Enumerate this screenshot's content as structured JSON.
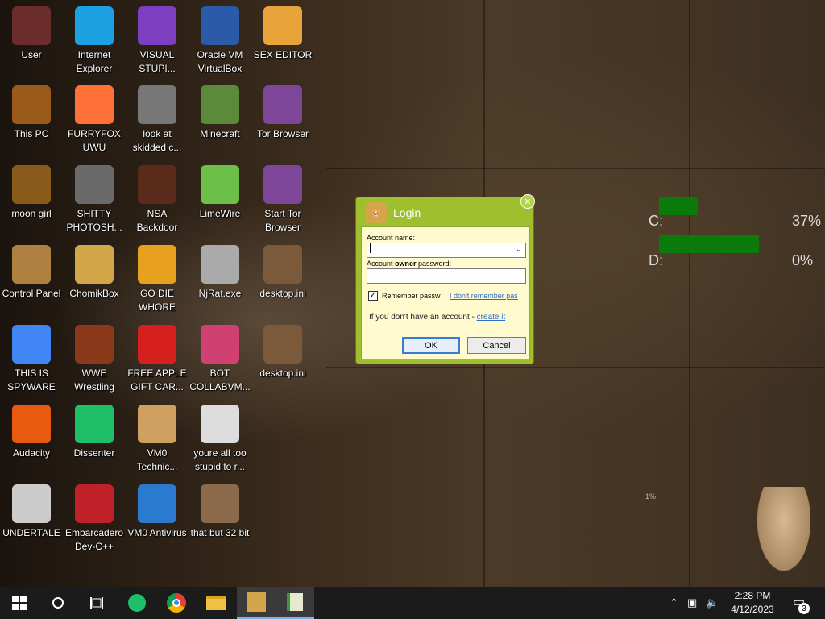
{
  "desktop_icons": [
    {
      "label": "User",
      "icon": "user-folder-icon",
      "color": "#6b2c2c"
    },
    {
      "label": "Internet Explorer",
      "icon": "edge-icon",
      "color": "#1ba1e2"
    },
    {
      "label": "VISUAL STUPI...",
      "icon": "visual-studio-icon",
      "color": "#7b3fbf"
    },
    {
      "label": "Oracle VM VirtualBox",
      "icon": "virtualbox-icon",
      "color": "#2a5aa8"
    },
    {
      "label": "SEX EDITOR",
      "icon": "hxd-icon",
      "color": "#e8a33a"
    },
    {
      "label": "This PC",
      "icon": "computer-icon",
      "color": "#9a5a1a"
    },
    {
      "label": "FURRYFOX UWU",
      "icon": "firefox-icon",
      "color": "#ff7139"
    },
    {
      "label": "look at skidded c...",
      "icon": "copy-icon",
      "color": "#777777"
    },
    {
      "label": "Minecraft",
      "icon": "minecraft-icon",
      "color": "#5a8a3a"
    },
    {
      "label": "Tor Browser",
      "icon": "tor-icon",
      "color": "#7d4698"
    },
    {
      "label": "moon girl",
      "icon": "book-icon",
      "color": "#8a5a1a"
    },
    {
      "label": "SHITTY PHOTOSH...",
      "icon": "gimp-icon",
      "color": "#6a6a6a"
    },
    {
      "label": "NSA Backdoor",
      "icon": "terminal-icon",
      "color": "#5a2a1a"
    },
    {
      "label": "LimeWire",
      "icon": "limewire-icon",
      "color": "#6cc04a"
    },
    {
      "label": "Start Tor Browser",
      "icon": "tor-icon",
      "color": "#7d4698"
    },
    {
      "label": "Control Panel",
      "icon": "lightbulb-icon",
      "color": "#b08040"
    },
    {
      "label": "ChomikBox",
      "icon": "chomikbox-icon",
      "color": "#d4a64a"
    },
    {
      "label": "GO DIE WHORE",
      "icon": "die-icon",
      "color": "#e8a020"
    },
    {
      "label": "NjRat.exe",
      "icon": "skull-icon",
      "color": "#aaaaaa"
    },
    {
      "label": "desktop.ini",
      "icon": "ini-file-icon",
      "color": "#7a5a3a"
    },
    {
      "label": "THIS IS SPYWARE",
      "icon": "chrome-icon",
      "color": "#4285f4"
    },
    {
      "label": "WWE Wrestling",
      "icon": "tv-icon",
      "color": "#8a3a1a"
    },
    {
      "label": "FREE APPLE GIFT CAR...",
      "icon": "apple-icon",
      "color": "#d62020"
    },
    {
      "label": "BOT COLLABVM...",
      "icon": "flash-icon",
      "color": "#d04070"
    },
    {
      "label": "desktop.ini",
      "icon": "ini-file-icon",
      "color": "#7a5a3a"
    },
    {
      "label": "Audacity",
      "icon": "audacity-icon",
      "color": "#e85a10"
    },
    {
      "label": "Dissenter",
      "icon": "dissenter-icon",
      "color": "#1fbf6a"
    },
    {
      "label": "VM0 Technic...",
      "icon": "technician-icon",
      "color": "#d0a060"
    },
    {
      "label": "youre all too stupid to r...",
      "icon": "portrait-icon",
      "color": "#dddddd"
    },
    {
      "label": "",
      "icon": "",
      "color": ""
    },
    {
      "label": "UNDERTALE",
      "icon": "unity-icon",
      "color": "#cccccc"
    },
    {
      "label": "Embarcadero Dev-C++",
      "icon": "devcpp-icon",
      "color": "#c0202a"
    },
    {
      "label": "VM0 Antivirus",
      "icon": "shield-icon",
      "color": "#2a7ad0"
    },
    {
      "label": "that but 32 bit",
      "icon": "portrait-icon",
      "color": "#8a6a4a"
    }
  ],
  "disk_gauge": {
    "drives": [
      {
        "label": "C:",
        "percent": "37%",
        "fill": 0.37
      },
      {
        "label": "D:",
        "percent": "0%",
        "fill": 0.0
      }
    ],
    "bar_color": "#0a7a0a"
  },
  "small_watermark": "1%",
  "login_dialog": {
    "title": "Login",
    "close_symbol": "✕",
    "account_name_label": "Account name:",
    "account_name_value": "",
    "password_label_pre": "Account ",
    "password_label_bold": "owner",
    "password_label_post": " password:",
    "remember_label": "Remember passw",
    "remember_checked": true,
    "forgot_link": "I don't remember pas",
    "no_account_text": "If you don't have an account - ",
    "create_link": "create it",
    "ok_label": "OK",
    "cancel_label": "Cancel"
  },
  "taskbar": {
    "items": [
      {
        "name": "start-button",
        "icon": "windows-logo-icon"
      },
      {
        "name": "search-button",
        "icon": "circle-search-icon"
      },
      {
        "name": "task-view-button",
        "icon": "task-view-icon"
      },
      {
        "name": "dissenter-taskbar",
        "icon": "dissenter-icon"
      },
      {
        "name": "chrome-taskbar",
        "icon": "chrome-icon"
      },
      {
        "name": "file-explorer-taskbar",
        "icon": "folder-icon"
      },
      {
        "name": "chomikbox-taskbar",
        "icon": "chomikbox-icon"
      },
      {
        "name": "hxd-taskbar",
        "icon": "hxd-icon"
      }
    ],
    "time": "2:28 PM",
    "date": "4/12/2023",
    "notifications_count": "3"
  }
}
